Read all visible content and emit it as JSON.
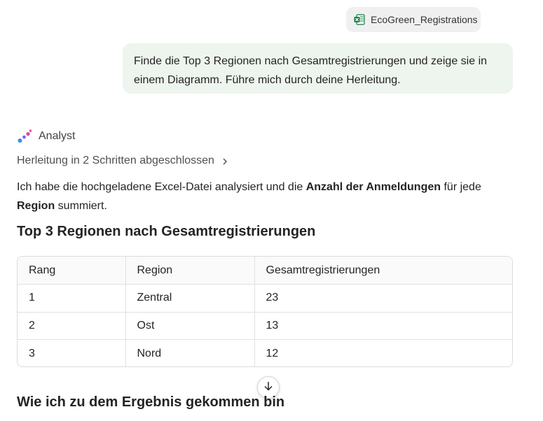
{
  "attachment": {
    "file_name": "EcoGreen_Registrations",
    "icon": "excel-file-icon"
  },
  "user_message": "Finde die Top 3 Regionen nach Gesamtregistrierungen und zeige sie in einem Diagramm. Führe mich durch deine Herleitung.",
  "assistant": {
    "name": "Analyst",
    "derivation_label": "Herleitung in 2 Schritten abgeschlossen",
    "summary": {
      "part1": "Ich habe die hochgeladene Excel-Datei analysiert und die ",
      "bold1": "Anzahl der Anmeldungen",
      "part2": " für jede ",
      "bold2": "Region",
      "part3": " summiert."
    },
    "table_title": "Top 3 Regionen nach Gesamtregistrierungen",
    "table": {
      "headers": [
        "Rang",
        "Region",
        "Gesamtregistrierungen"
      ],
      "rows": [
        [
          "1",
          "Zentral",
          "23"
        ],
        [
          "2",
          "Ost",
          "13"
        ],
        [
          "3",
          "Nord",
          "12"
        ]
      ]
    },
    "next_section_title": "Wie ich zu dem Ergebnis gekommen bin"
  },
  "colors": {
    "user_bubble": "#edf5ee",
    "chip": "#f0f0f0",
    "excel_green": "#107c41"
  }
}
